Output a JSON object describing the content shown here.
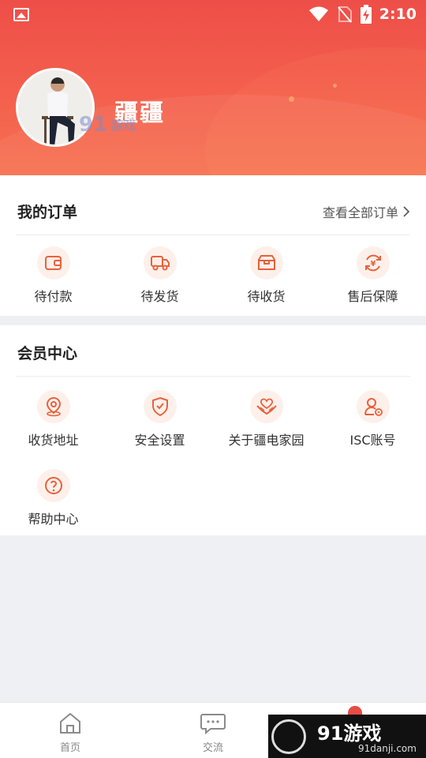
{
  "status_bar": {
    "time": "2:10"
  },
  "profile": {
    "username": "疆疆"
  },
  "orders": {
    "title": "我的订单",
    "view_all": "查看全部订单",
    "items": [
      {
        "label": "待付款",
        "icon": "wallet-icon"
      },
      {
        "label": "待发货",
        "icon": "truck-icon"
      },
      {
        "label": "待收货",
        "icon": "box-icon"
      },
      {
        "label": "售后保障",
        "icon": "yuan-refresh-icon"
      }
    ]
  },
  "member": {
    "title": "会员中心",
    "items": [
      {
        "label": "收货地址",
        "icon": "location-pin-icon"
      },
      {
        "label": "安全设置",
        "icon": "shield-check-icon"
      },
      {
        "label": "关于疆电家园",
        "icon": "heart-hands-icon"
      },
      {
        "label": "ISC账号",
        "icon": "user-link-icon"
      },
      {
        "label": "帮助中心",
        "icon": "question-icon"
      }
    ]
  },
  "bottom_nav": {
    "items": [
      {
        "label": "首页",
        "icon": "home-icon"
      },
      {
        "label": "交流",
        "icon": "chat-icon"
      }
    ]
  },
  "watermark": {
    "brand": "91游戏",
    "site": "91danji.com",
    "overlay_site": "91danji.com"
  },
  "colors": {
    "header_start": "#ee4e48",
    "header_end": "#f6714f",
    "icon_accent": "#e8613c",
    "icon_bg": "#fdf0ea",
    "page_bg": "#eef0f3"
  }
}
